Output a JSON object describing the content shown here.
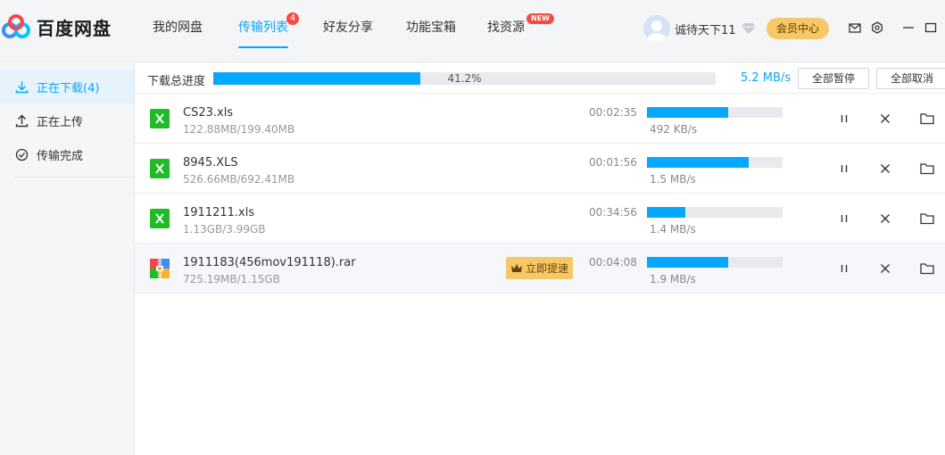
{
  "app": {
    "name": "百度网盘"
  },
  "nav": {
    "tabs": [
      {
        "label": "我的网盘",
        "active": false
      },
      {
        "label": "传输列表",
        "active": true,
        "badge": "4"
      },
      {
        "label": "好友分享",
        "active": false
      },
      {
        "label": "功能宝箱",
        "active": false
      },
      {
        "label": "找资源",
        "active": false,
        "badge": "NEW"
      }
    ]
  },
  "user": {
    "name": "诚待天下11",
    "vip_center_label": "会员中心"
  },
  "sidebar": {
    "items": [
      {
        "label": "正在下载(4)",
        "icon": "download-icon",
        "active": true
      },
      {
        "label": "正在上传",
        "icon": "upload-icon",
        "active": false
      },
      {
        "label": "传输完成",
        "icon": "check-circle-icon",
        "active": false
      }
    ]
  },
  "toolbar": {
    "total_label": "下载总进度",
    "total_percent": "41.2%",
    "total_progress": 0.412,
    "total_speed": "5.2 MB/s",
    "pause_all_label": "全部暂停",
    "cancel_all_label": "全部取消"
  },
  "downloads": [
    {
      "name": "CS23.xls",
      "size": "122.88MB/199.40MB",
      "remaining": "00:02:35",
      "speed": "492 KB/s",
      "progress": 0.6,
      "type": "excel-file-icon",
      "boost": false
    },
    {
      "name": "8945.XLS",
      "size": "526.66MB/692.41MB",
      "remaining": "00:01:56",
      "speed": "1.5 MB/s",
      "progress": 0.75,
      "type": "excel-file-icon",
      "boost": false
    },
    {
      "name": "1911211.xls",
      "size": "1.13GB/3.99GB",
      "remaining": "00:34:56",
      "speed": "1.4 MB/s",
      "progress": 0.28,
      "type": "excel-file-icon",
      "boost": false
    },
    {
      "name": "1911183(456mov191118).rar",
      "size": "725.19MB/1.15GB",
      "remaining": "00:04:08",
      "speed": "1.9 MB/s",
      "progress": 0.6,
      "type": "rar-file-icon",
      "boost": true,
      "boost_label": "立即提速"
    }
  ],
  "colors": {
    "accent": "#06a7ff",
    "vip_gold": "#f6c867",
    "badge_red": "#f54a45",
    "excel_green": "#1fbc27"
  }
}
